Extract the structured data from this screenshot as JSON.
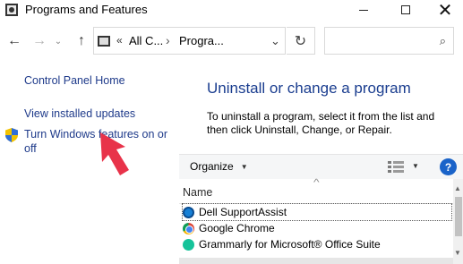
{
  "window": {
    "title": "Programs and Features"
  },
  "window_controls": {
    "minimize": "minimize",
    "maximize": "maximize",
    "close": "✕"
  },
  "navigation": {
    "back": "←",
    "forward": "→",
    "recent": "⌄",
    "up": "↑",
    "address_chevron": "«",
    "breadcrumb_1": "All C...",
    "breadcrumb_separator": "›",
    "breadcrumb_2": "Progra...",
    "address_dropdown": "⌄",
    "refresh": "↻",
    "search_icon": "⌕"
  },
  "sidebar": {
    "items": [
      {
        "label": "Control Panel Home"
      },
      {
        "label": "View installed updates"
      },
      {
        "label": "Turn Windows features on or off",
        "icon": "uac-shield-icon"
      }
    ]
  },
  "annotation": {
    "arrow_color": "#e8334a",
    "arrow_icon": "pointer-arrow-icon"
  },
  "main": {
    "title": "Uninstall or change a program",
    "description": "To uninstall a program, select it from the list and then click Uninstall, Change, or Repair."
  },
  "toolbar": {
    "organize_label": "Organize",
    "organize_caret": "▼",
    "view_caret": "▼",
    "help_label": "?"
  },
  "list": {
    "sort_indicator": "^",
    "column_name": "Name",
    "programs": [
      {
        "name": "Dell SupportAssist",
        "icon": "dell-supportassist-icon"
      },
      {
        "name": "Google Chrome",
        "icon": "chrome-icon"
      },
      {
        "name": "Grammarly for Microsoft® Office Suite",
        "icon": "grammarly-icon"
      }
    ],
    "scroll_up": "▲",
    "scroll_down": "▼"
  },
  "colors": {
    "link": "#1e3a8a",
    "title": "#1a3d8f",
    "help": "#1a63c9"
  }
}
